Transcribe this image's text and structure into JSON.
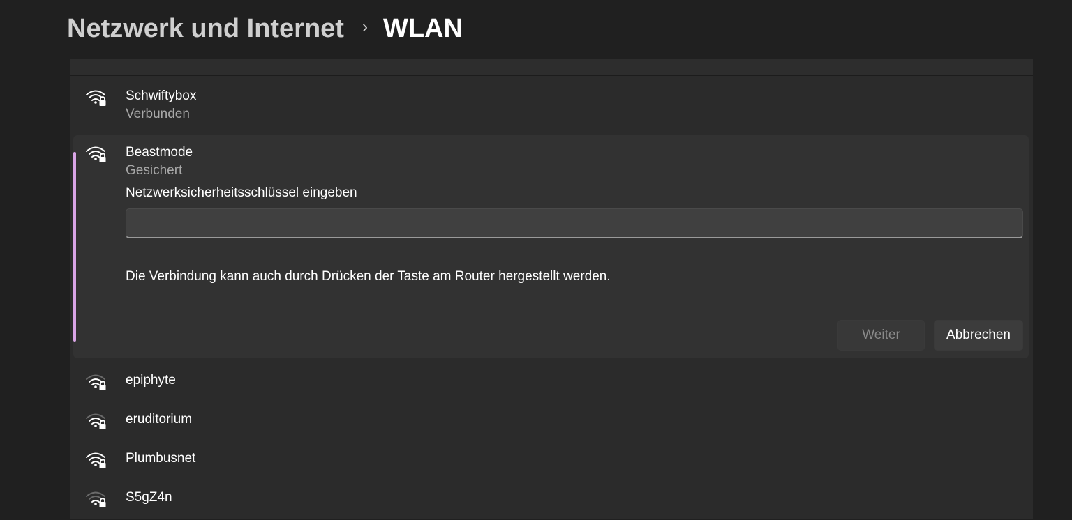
{
  "breadcrumb": {
    "parent": "Netzwerk und Internet",
    "separator": "›",
    "current": "WLAN"
  },
  "networks": [
    {
      "name": "Schwiftybox",
      "status": "Verbunden",
      "icon": "wifi-secured-icon"
    },
    {
      "name": "Beastmode",
      "status": "Gesichert",
      "icon": "wifi-secured-icon"
    },
    {
      "name": "epiphyte",
      "icon": "wifi-secured-icon"
    },
    {
      "name": "eruditorium",
      "icon": "wifi-secured-icon"
    },
    {
      "name": "Plumbusnet",
      "icon": "wifi-secured-icon"
    },
    {
      "name": "S5gZ4n",
      "icon": "wifi-secured-icon"
    }
  ],
  "connect_form": {
    "key_label": "Netzwerksicherheitsschlüssel eingeben",
    "key_value": "",
    "wps_hint": "Die Verbindung kann auch durch Drücken der Taste am Router hergestellt werden.",
    "next_label": "Weiter",
    "cancel_label": "Abbrechen"
  },
  "colors": {
    "background": "#202020",
    "card": "#2b2b2b",
    "accent": "#d9a5e6"
  }
}
